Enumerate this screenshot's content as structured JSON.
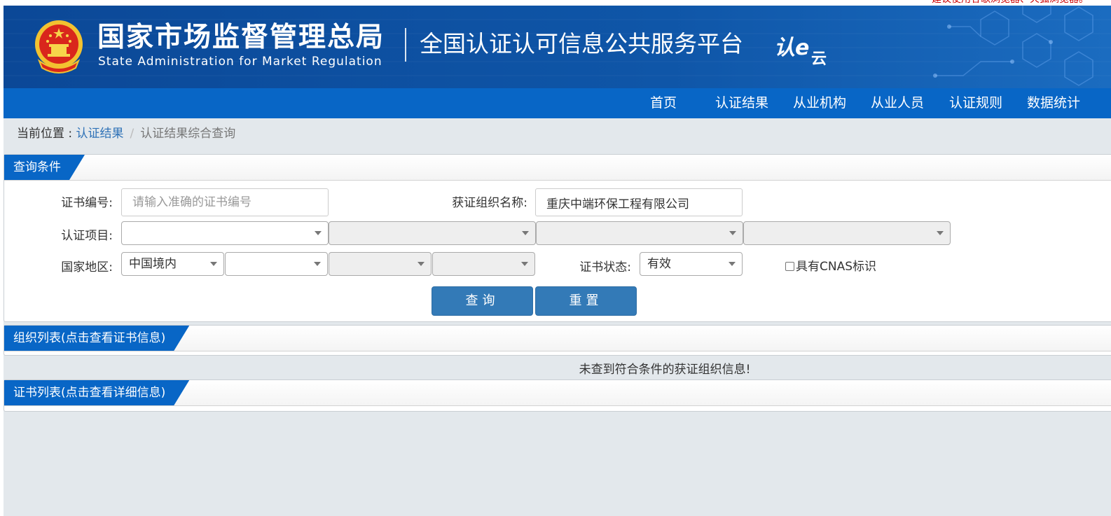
{
  "notice": "建议使用谷歌浏览器、火狐浏览器。",
  "header": {
    "org_name_cn": "国家市场监督管理总局",
    "org_name_en": "State Administration  for  Market Regulation",
    "platform_name": "全国认证认可信息公共服务平台",
    "logo_main": "认e",
    "logo_sub": "云"
  },
  "nav": {
    "items": [
      {
        "label": "首页"
      },
      {
        "label": "认证结果"
      },
      {
        "label": "从业机构"
      },
      {
        "label": "从业人员"
      },
      {
        "label": "认证规则"
      },
      {
        "label": "数据统计"
      }
    ]
  },
  "breadcrumb": {
    "label": "当前位置 : ",
    "link": "认证结果",
    "separator": "/",
    "current": "认证结果综合查询"
  },
  "query": {
    "title": "查询条件",
    "cert_no_label": "证书编号:",
    "cert_no_placeholder": "请输入准确的证书编号",
    "cert_no_value": "",
    "org_name_label": "获证组织名称:",
    "org_name_value": "重庆中端环保工程有限公司",
    "project_label": "认证项目:",
    "project_selects": [
      "",
      "",
      "",
      ""
    ],
    "region_label": "国家地区:",
    "region_selects": [
      "中国境内",
      "",
      "",
      ""
    ],
    "status_label": "证书状态:",
    "status_value": "有效",
    "cnas_label": "具有CNAS标识",
    "cnas_checked": false,
    "search_button": "查询",
    "reset_button": "重置"
  },
  "org_list": {
    "title": "组织列表(点击查看证书信息)",
    "empty_message": "未查到符合条件的获证组织信息!"
  },
  "cert_list": {
    "title": "证书列表(点击查看详细信息)"
  },
  "colors": {
    "header_bg": "#0d4d9e",
    "nav_bg": "#0866c6",
    "button_bg": "#337ab7",
    "page_bg": "#e3e8ec",
    "link": "#2f72b7"
  }
}
